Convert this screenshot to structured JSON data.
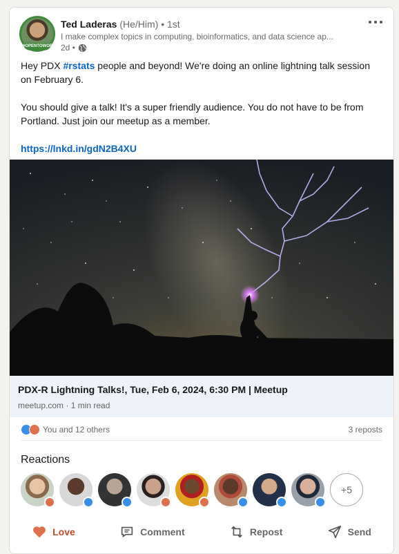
{
  "post": {
    "author_name": "Ted Laderas",
    "pronouns": "(He/Him)",
    "degree": "• 1st",
    "headline": "I make complex topics in computing, bioinformatics, and data science ap...",
    "time": "2d •",
    "avatar_badge": "#OPENTOWORK",
    "text_1a": "Hey PDX ",
    "hashtag": "#rstats",
    "text_1b": " people and beyond! We're doing an online lightning talk session on February 6.",
    "text_2": "You should give a talk! It's a super friendly audience. You do not have to be from Portland. Just join our meetup as a member.",
    "link": "https://lnkd.in/gdN2B4XU"
  },
  "link_preview": {
    "title": "PDX-R Lightning Talks!, Tue, Feb 6, 2024, 6:30 PM | Meetup",
    "source": "meetup.com · 1 min read"
  },
  "social": {
    "reactions_text": "You and 12 others",
    "reposts": "3 reposts"
  },
  "reactions": {
    "heading": "Reactions",
    "more": "+5"
  },
  "actions": {
    "love": "Love",
    "comment": "Comment",
    "repost": "Repost",
    "send": "Send"
  },
  "colors": {
    "accent": "#0a66c2",
    "love": "#c04a2a",
    "like_badge": "#378fe9",
    "love_badge": "#df704d"
  }
}
